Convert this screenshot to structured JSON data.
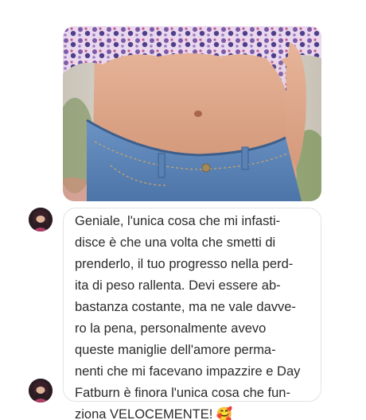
{
  "message": {
    "lines": [
      "Geniale, l'unica cosa che mi infasti-",
      "disce è che una volta che smetti di",
      "prenderlo, il tuo progresso nella perd-",
      "ita di peso rallenta. Devi essere ab-",
      "bastanza costante, ma ne vale davve-",
      "ro la pena, personalmente avevo",
      "queste maniglie dell'amore perma-",
      "nenti che mi facevano impazzire e Day",
      "Fatburn è finora l'unica cosa che fun-",
      "ziona VELOCEMENTE! 🥰"
    ]
  },
  "colors": {
    "bubble_border": "#e3e3e3",
    "text": "#2b2b2b",
    "denim": "#5a82b4",
    "skin": "#dca27f",
    "top_pattern": "#7a5aa0"
  }
}
